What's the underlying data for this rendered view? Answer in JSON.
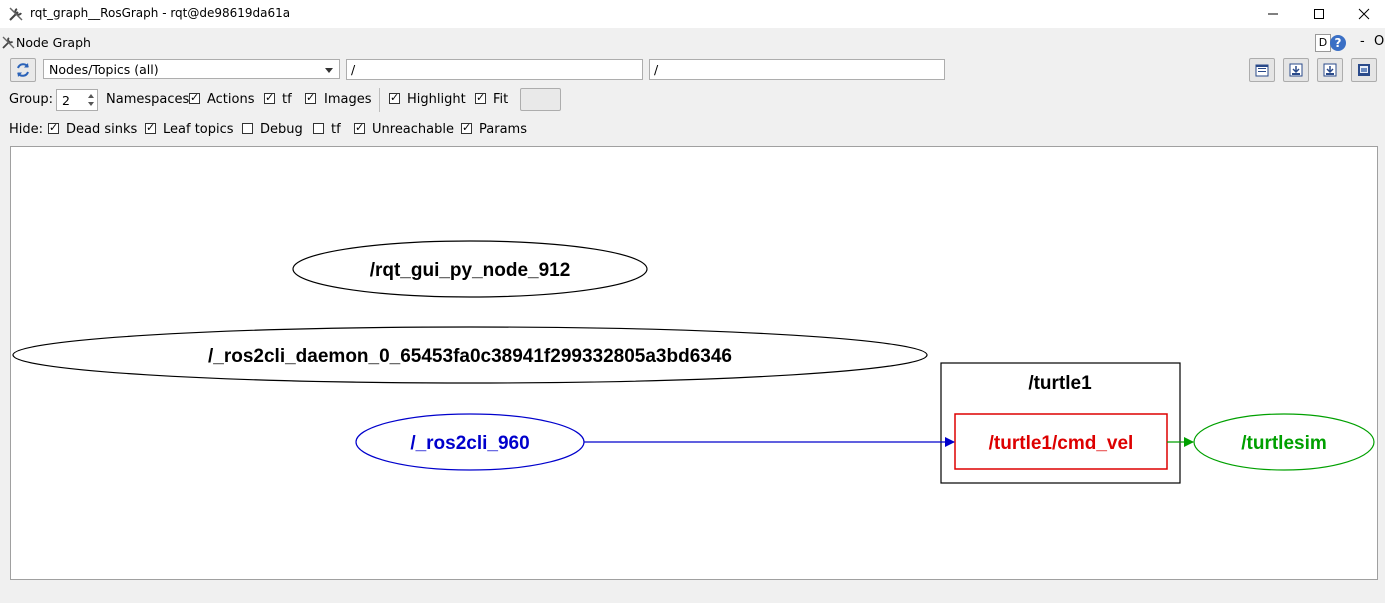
{
  "window": {
    "title": "rqt_graph__RosGraph - rqt@de98619da61a",
    "icon": "wrench-icon"
  },
  "dock": {
    "title": "Node Graph",
    "d_label": "D",
    "help_label": "?",
    "dash_label": "-",
    "o_label": "O"
  },
  "toolbar": {
    "graph_type": "Nodes/Topics (all)",
    "node_filter": "/",
    "topic_filter": "/",
    "buttons": [
      "load-icon",
      "save-dot-icon",
      "save-svg-icon",
      "save-image-icon"
    ]
  },
  "options": {
    "group_label": "Group:",
    "group_value": "2",
    "namespaces_label": "Namespaces",
    "actions": {
      "label": "Actions",
      "checked": true
    },
    "tf": {
      "label": "tf",
      "checked": true
    },
    "images": {
      "label": "Images",
      "checked": true
    },
    "highlight": {
      "label": "Highlight",
      "checked": true
    },
    "fit": {
      "label": "Fit",
      "checked": true
    }
  },
  "hide": {
    "label": "Hide:",
    "items": [
      {
        "label": "Dead sinks",
        "checked": true
      },
      {
        "label": "Leaf topics",
        "checked": true
      },
      {
        "label": "Debug",
        "checked": false
      },
      {
        "label": "tf",
        "checked": false
      },
      {
        "label": "Unreachable",
        "checked": true
      },
      {
        "label": "Params",
        "checked": true
      }
    ]
  },
  "graph": {
    "nodes": [
      {
        "label": "/rqt_gui_py_node_912",
        "color": "#000000"
      },
      {
        "label": "/_ros2cli_daemon_0_65453fa0c38941f299332805a3bd6346",
        "color": "#000000"
      },
      {
        "label": "/_ros2cli_960",
        "color": "#0000cc"
      },
      {
        "label": "/turtlesim",
        "color": "#00a000"
      }
    ],
    "namespace_box": {
      "label": "/turtle1"
    },
    "topic": {
      "label": "/turtle1/cmd_vel",
      "color": "#dd0000"
    },
    "edges": [
      {
        "from": "/_ros2cli_960",
        "to": "/turtle1/cmd_vel",
        "color": "#0000cc"
      },
      {
        "from": "/turtle1/cmd_vel",
        "to": "/turtlesim",
        "color": "#00a000"
      }
    ]
  }
}
